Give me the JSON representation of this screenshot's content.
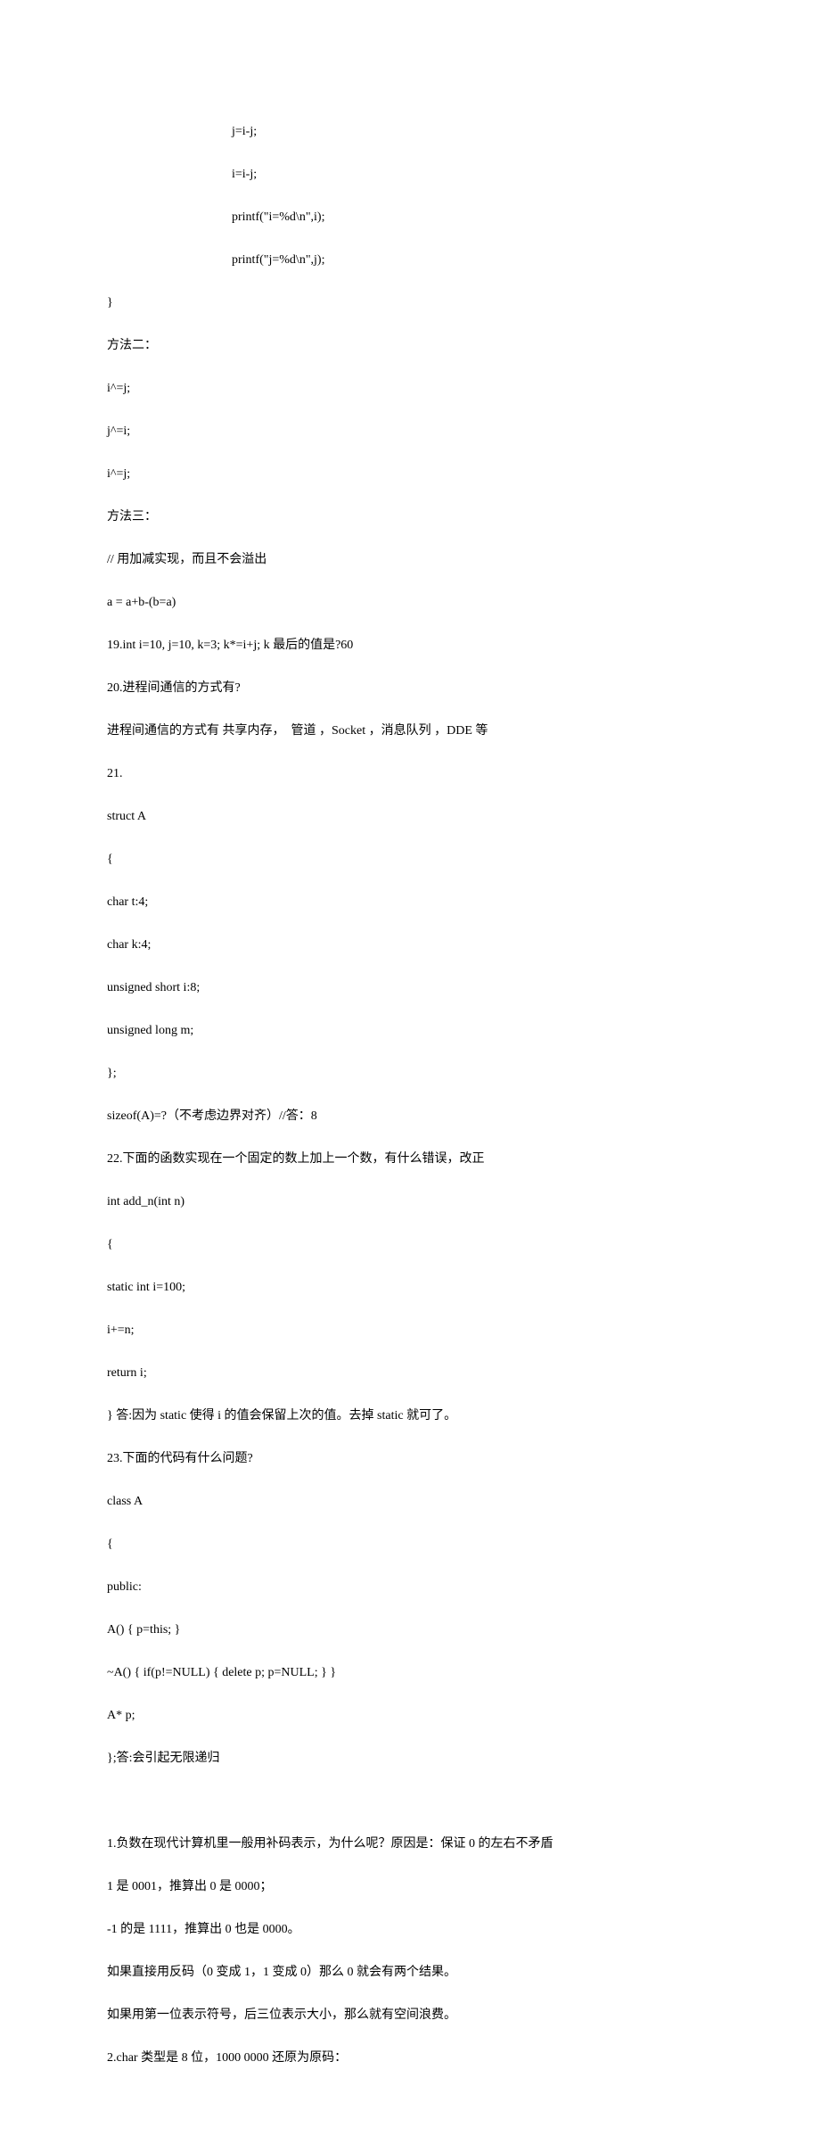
{
  "lines": [
    "j=i-j;",
    "i=i-j;",
    "printf(\"i=%d\\n\",i);",
    "printf(\"j=%d\\n\",j);",
    "}",
    "方法二：",
    "i^=j;",
    "j^=i;",
    "i^=j;",
    "方法三：",
    "// 用加减实现，而且不会溢出",
    "a = a+b-(b=a)",
    "19.int i=10, j=10, k=3; k*=i+j; k 最后的值是?60",
    "20.进程间通信的方式有?",
    "进程间通信的方式有 共享内存，  管道 ，Socket ，消息队列 ，DDE 等",
    "21.",
    "struct A",
    "{",
    "char t:4;",
    "char k:4;",
    "unsigned short i:8;",
    "unsigned long m;",
    "};",
    "sizeof(A)=?（不考虑边界对齐）//答：8",
    "22.下面的函数实现在一个固定的数上加上一个数，有什么错误，改正",
    "int add_n(int n)",
    "{",
    "static int i=100;",
    "i+=n;",
    "return i;",
    "} 答:因为 static 使得 i 的值会保留上次的值。去掉 static 就可了。",
    "23.下面的代码有什么问题?",
    "class A",
    "{",
    "public:",
    "A() { p=this; }",
    "~A() { if(p!=NULL) { delete p; p=NULL; } }",
    "A* p;",
    "};答:会引起无限递归",
    "",
    "1.负数在现代计算机里一般用补码表示，为什么呢？原因是：保证 0 的左右不矛盾",
    "1 是 0001，推算出 0 是 0000；",
    "-1 的是 1111，推算出 0 也是 0000。",
    "如果直接用反码（0 变成 1，1 变成 0）那么 0 就会有两个结果。",
    "如果用第一位表示符号，后三位表示大小，那么就有空间浪费。",
    "2.char 类型是 8 位，1000 0000 还原为原码："
  ]
}
